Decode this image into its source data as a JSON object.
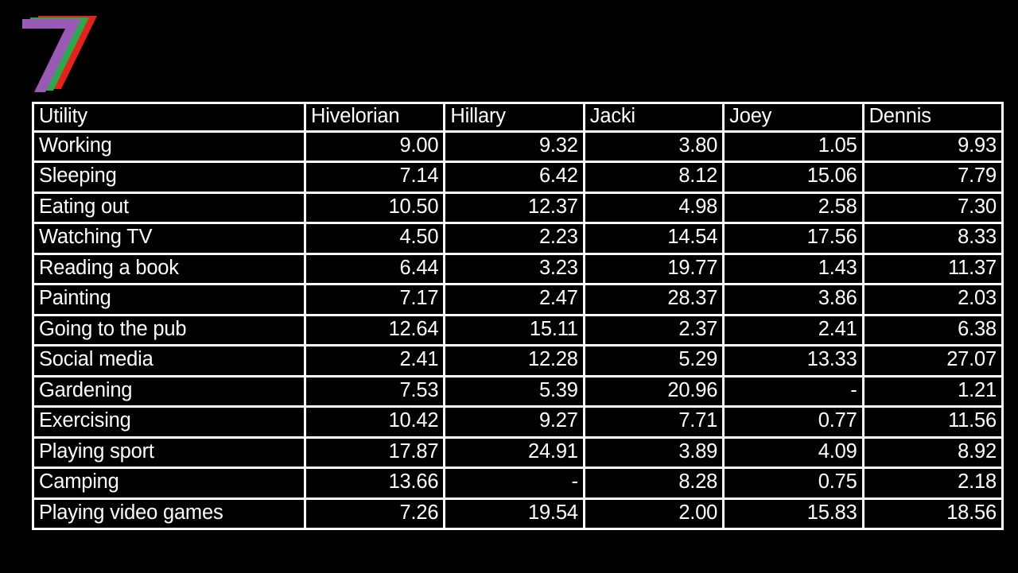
{
  "logo": {
    "name": "seven-chevron-logo",
    "colors": {
      "outer": "#e8201a",
      "middle": "#2aa84a",
      "inner": "#9b59b6"
    }
  },
  "theme": {
    "background": "#000000",
    "text": "#ffffff",
    "gridline": "#ffffff"
  },
  "table": {
    "headers": [
      "Utility",
      "Hivelorian",
      "Hillary",
      "Jacki",
      "Joey",
      "Dennis"
    ],
    "rows": [
      {
        "label": "Working",
        "values": [
          "9.00",
          "9.32",
          "3.80",
          "1.05",
          "9.93"
        ]
      },
      {
        "label": "Sleeping",
        "values": [
          "7.14",
          "6.42",
          "8.12",
          "15.06",
          "7.79"
        ]
      },
      {
        "label": "Eating out",
        "values": [
          "10.50",
          "12.37",
          "4.98",
          "2.58",
          "7.30"
        ]
      },
      {
        "label": "Watching TV",
        "values": [
          "4.50",
          "2.23",
          "14.54",
          "17.56",
          "8.33"
        ]
      },
      {
        "label": "Reading a book",
        "values": [
          "6.44",
          "3.23",
          "19.77",
          "1.43",
          "11.37"
        ]
      },
      {
        "label": "Painting",
        "values": [
          "7.17",
          "2.47",
          "28.37",
          "3.86",
          "2.03"
        ]
      },
      {
        "label": "Going to the pub",
        "values": [
          "12.64",
          "15.11",
          "2.37",
          "2.41",
          "6.38"
        ]
      },
      {
        "label": "Social media",
        "values": [
          "2.41",
          "12.28",
          "5.29",
          "13.33",
          "27.07"
        ]
      },
      {
        "label": "Gardening",
        "values": [
          "7.53",
          "5.39",
          "20.96",
          "-",
          "1.21"
        ]
      },
      {
        "label": "Exercising",
        "values": [
          "10.42",
          "9.27",
          "7.71",
          "0.77",
          "11.56"
        ]
      },
      {
        "label": "Playing sport",
        "values": [
          "17.87",
          "24.91",
          "3.89",
          "4.09",
          "8.92"
        ]
      },
      {
        "label": "Camping",
        "values": [
          "13.66",
          "-",
          "8.28",
          "0.75",
          "2.18"
        ]
      },
      {
        "label": "Playing video games",
        "values": [
          "7.26",
          "19.54",
          "2.00",
          "15.83",
          "18.56"
        ]
      }
    ]
  },
  "chart_data": {
    "type": "table",
    "title": "",
    "categories": [
      "Working",
      "Sleeping",
      "Eating out",
      "Watching TV",
      "Reading a book",
      "Painting",
      "Going to the pub",
      "Social media",
      "Gardening",
      "Exercising",
      "Playing sport",
      "Camping",
      "Playing video games"
    ],
    "xlabel": "Utility",
    "ylabel": "",
    "series": [
      {
        "name": "Hivelorian",
        "values": [
          9.0,
          7.14,
          10.5,
          4.5,
          6.44,
          7.17,
          12.64,
          2.41,
          7.53,
          10.42,
          17.87,
          13.66,
          7.26
        ]
      },
      {
        "name": "Hillary",
        "values": [
          9.32,
          6.42,
          12.37,
          2.23,
          3.23,
          2.47,
          15.11,
          12.28,
          5.39,
          9.27,
          24.91,
          null,
          19.54
        ]
      },
      {
        "name": "Jacki",
        "values": [
          3.8,
          8.12,
          4.98,
          14.54,
          19.77,
          28.37,
          2.37,
          5.29,
          20.96,
          7.71,
          3.89,
          8.28,
          2.0
        ]
      },
      {
        "name": "Joey",
        "values": [
          1.05,
          15.06,
          2.58,
          17.56,
          1.43,
          3.86,
          2.41,
          13.33,
          null,
          0.77,
          4.09,
          0.75,
          15.83
        ]
      },
      {
        "name": "Dennis",
        "values": [
          9.93,
          7.79,
          7.3,
          8.33,
          11.37,
          2.03,
          6.38,
          27.07,
          1.21,
          11.56,
          8.92,
          2.18,
          18.56
        ]
      }
    ]
  }
}
